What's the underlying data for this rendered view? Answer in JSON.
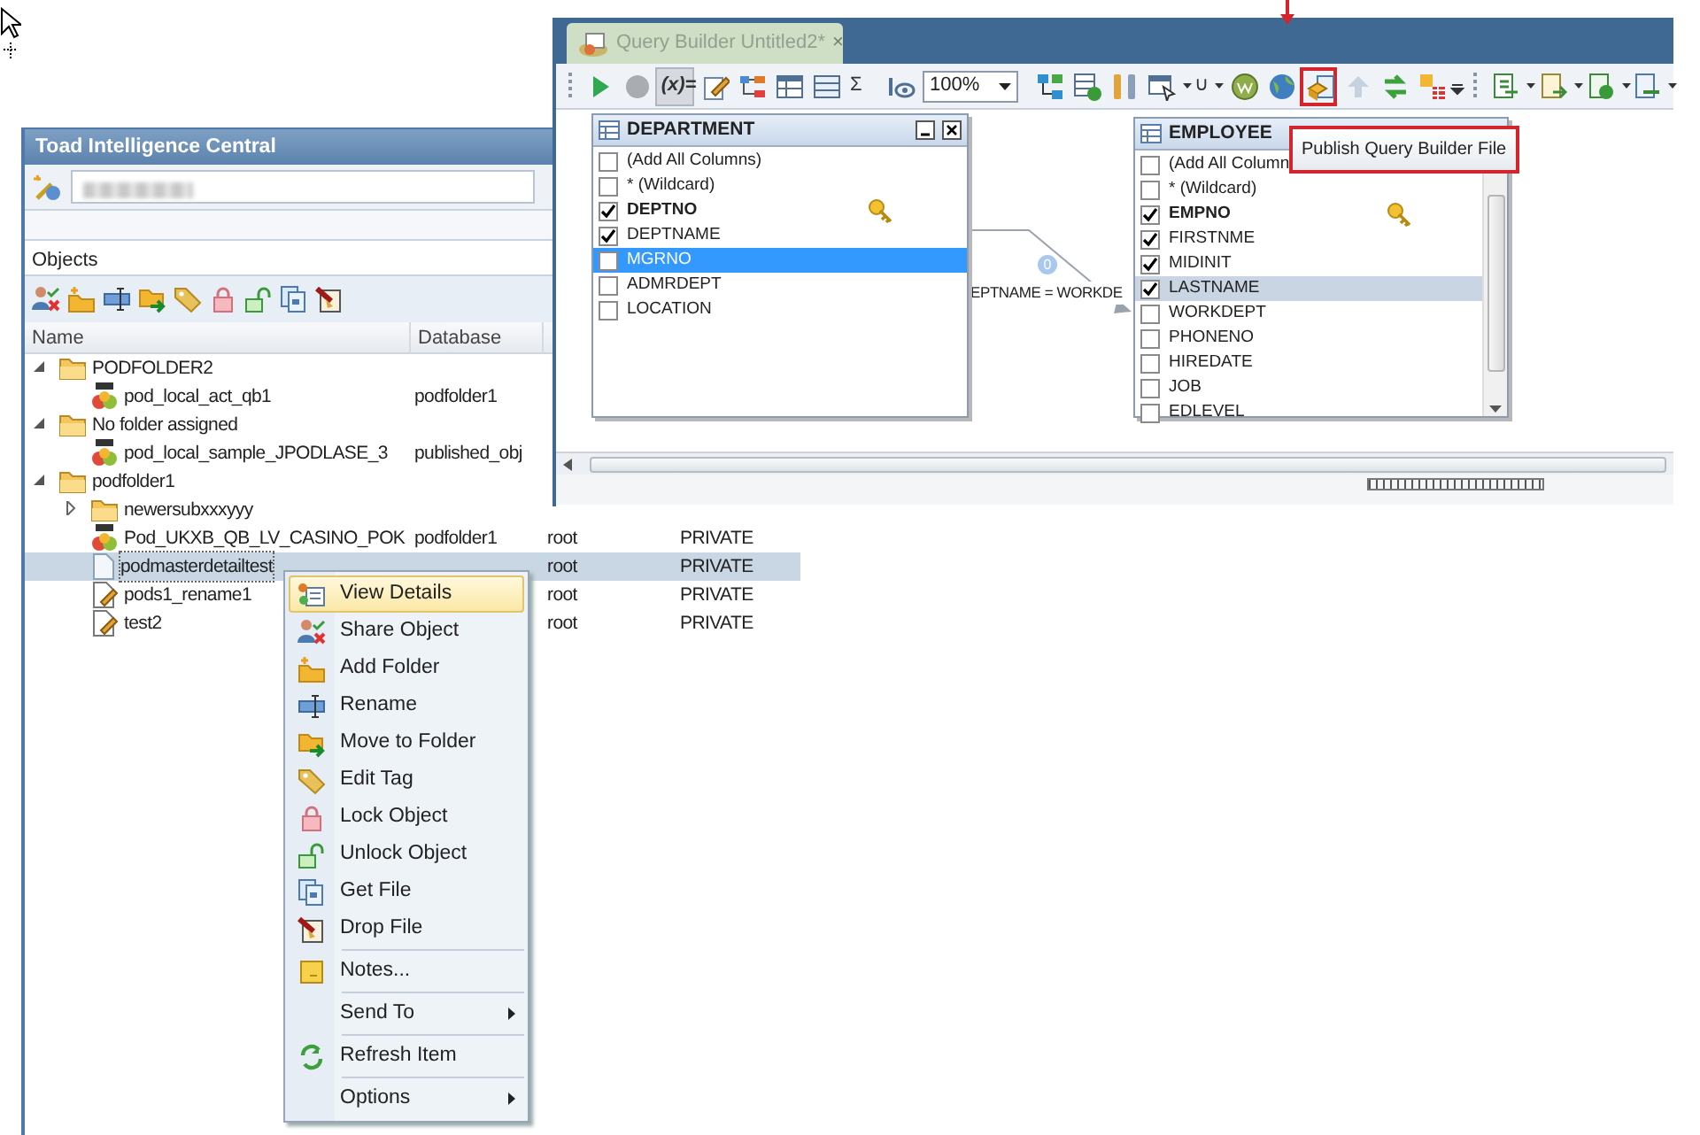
{
  "objects_panel": {
    "title": "Toad Intelligence Central",
    "section": "Objects",
    "columns": [
      "Name",
      "Database"
    ],
    "tree": [
      {
        "name": "PODFOLDER2",
        "kind": "folder",
        "expanded": true,
        "selected": false,
        "children": [
          {
            "name": "pod_local_act_qb1",
            "kind": "query",
            "database": "podfolder1",
            "selected": false
          }
        ]
      },
      {
        "name": "No folder assigned",
        "kind": "folder",
        "expanded": true,
        "selected": false,
        "children": [
          {
            "name": "pod_local_sample_JPODLASE_3",
            "kind": "query",
            "database": "published_obj",
            "selected": false
          }
        ]
      },
      {
        "name": "podfolder1",
        "kind": "folder",
        "expanded": true,
        "selected": false,
        "children": [
          {
            "name": "newersubxxxyyy",
            "kind": "folder",
            "expanded": false,
            "selected": false
          },
          {
            "name": "Pod_UKXB_QB_LV_CASINO_POK",
            "kind": "query",
            "database": "podfolder1",
            "owner": "root",
            "visibility": "PRIVATE",
            "selected": false
          },
          {
            "name": "podmasterdetailtest",
            "kind": "document",
            "owner": "root",
            "visibility": "PRIVATE",
            "selected": true
          },
          {
            "name": "pods1_rename1",
            "kind": "edited",
            "owner": "root",
            "visibility": "PRIVATE",
            "selected": false
          },
          {
            "name": "test2",
            "kind": "edited",
            "owner": "root",
            "visibility": "PRIVATE",
            "selected": false
          }
        ]
      }
    ]
  },
  "query_builder": {
    "tab": {
      "title": "Query Builder Untitled2*",
      "close": "×"
    },
    "toolbar": [
      {
        "kind": "grip"
      },
      {
        "kind": "icon",
        "highlighted": false,
        "disabled": false,
        "dropdown": false
      },
      {
        "kind": "icon",
        "highlighted": false,
        "disabled": false,
        "dropdown": false
      },
      {
        "kind": "text",
        "label": "(x)=",
        "pressed": true,
        "dropdown": false
      },
      {
        "kind": "icon",
        "highlighted": false,
        "disabled": false,
        "dropdown": false
      },
      {
        "kind": "icon",
        "highlighted": false,
        "disabled": false,
        "dropdown": false
      },
      {
        "kind": "icon",
        "highlighted": false,
        "disabled": false,
        "dropdown": false
      },
      {
        "kind": "icon",
        "highlighted": false,
        "disabled": false,
        "dropdown": false
      },
      {
        "kind": "text",
        "label": "Σ",
        "pressed": false,
        "dropdown": false
      },
      {
        "kind": "icon",
        "highlighted": false,
        "disabled": false,
        "dropdown": false
      },
      {
        "kind": "select",
        "value": "100%"
      },
      {
        "kind": "icon",
        "highlighted": false,
        "disabled": false,
        "dropdown": false
      },
      {
        "kind": "icon",
        "highlighted": false,
        "disabled": false,
        "dropdown": false
      },
      {
        "kind": "icon",
        "highlighted": false,
        "disabled": false,
        "dropdown": false
      },
      {
        "kind": "icon",
        "highlighted": false,
        "disabled": false,
        "dropdown": true
      },
      {
        "kind": "text",
        "label": "∪",
        "pressed": false,
        "dropdown": true
      },
      {
        "kind": "icon",
        "highlighted": false,
        "disabled": false,
        "dropdown": false
      },
      {
        "kind": "icon",
        "highlighted": false,
        "disabled": false,
        "dropdown": false
      },
      {
        "kind": "icon",
        "highlighted": true,
        "disabled": false,
        "dropdown": false
      },
      {
        "kind": "icon",
        "highlighted": false,
        "disabled": true,
        "dropdown": false
      },
      {
        "kind": "icon",
        "highlighted": false,
        "disabled": false,
        "dropdown": false
      },
      {
        "kind": "icon",
        "highlighted": false,
        "disabled": false,
        "dropdown": false
      },
      {
        "kind": "overflow"
      },
      {
        "kind": "grip"
      },
      {
        "kind": "icon",
        "highlighted": false,
        "disabled": false,
        "dropdown": true
      },
      {
        "kind": "icon",
        "highlighted": false,
        "disabled": false,
        "dropdown": true
      },
      {
        "kind": "icon",
        "highlighted": false,
        "disabled": false,
        "dropdown": true
      },
      {
        "kind": "icon",
        "highlighted": false,
        "disabled": false,
        "dropdown": true
      }
    ],
    "tables": [
      {
        "title": "DEPARTMENT",
        "window_controls": true,
        "scrollable": false,
        "columns": [
          {
            "label": "(Add All Columns)",
            "checked": false,
            "primary_key": false,
            "selected": false,
            "hovered": false
          },
          {
            "label": "* (Wildcard)",
            "checked": false,
            "primary_key": false,
            "selected": false,
            "hovered": false
          },
          {
            "label": "DEPTNO",
            "checked": true,
            "primary_key": true,
            "selected": false,
            "hovered": false
          },
          {
            "label": "DEPTNAME",
            "checked": true,
            "primary_key": false,
            "selected": false,
            "hovered": false
          },
          {
            "label": "MGRNO",
            "checked": false,
            "primary_key": false,
            "selected": true,
            "hovered": false
          },
          {
            "label": "ADMRDEPT",
            "checked": false,
            "primary_key": false,
            "selected": false,
            "hovered": false
          },
          {
            "label": "LOCATION",
            "checked": false,
            "primary_key": false,
            "selected": false,
            "hovered": false
          }
        ]
      },
      {
        "title": "EMPLOYEE",
        "window_controls": false,
        "scrollable": true,
        "columns": [
          {
            "label": "(Add All Column",
            "checked": false,
            "primary_key": false,
            "selected": false,
            "hovered": false
          },
          {
            "label": "* (Wildcard)",
            "checked": false,
            "primary_key": false,
            "selected": false,
            "hovered": false
          },
          {
            "label": "EMPNO",
            "checked": true,
            "primary_key": true,
            "selected": false,
            "hovered": false
          },
          {
            "label": "FIRSTNME",
            "checked": true,
            "primary_key": false,
            "selected": false,
            "hovered": false
          },
          {
            "label": "MIDINIT",
            "checked": true,
            "primary_key": false,
            "selected": false,
            "hovered": false
          },
          {
            "label": "LASTNAME",
            "checked": true,
            "primary_key": false,
            "selected": false,
            "hovered": true
          },
          {
            "label": "WORKDEPT",
            "checked": false,
            "primary_key": false,
            "selected": false,
            "hovered": false
          },
          {
            "label": "PHONENO",
            "checked": false,
            "primary_key": false,
            "selected": false,
            "hovered": false
          },
          {
            "label": "HIREDATE",
            "checked": false,
            "primary_key": false,
            "selected": false,
            "hovered": false
          },
          {
            "label": "JOB",
            "checked": false,
            "primary_key": false,
            "selected": false,
            "hovered": false
          },
          {
            "label": "EDLEVEL",
            "checked": false,
            "primary_key": false,
            "selected": false,
            "hovered": false
          }
        ]
      }
    ],
    "join": {
      "label": "EPTNAME = WORKDE",
      "badge": "0"
    },
    "tooltip": "Publish Query Builder File"
  },
  "context_menu": {
    "items": [
      {
        "kind": "item",
        "label": "View Details",
        "icon": true,
        "highlighted": true,
        "submenu": false
      },
      {
        "kind": "item",
        "label": "Share Object",
        "icon": true,
        "highlighted": false,
        "submenu": false
      },
      {
        "kind": "item",
        "label": "Add Folder",
        "icon": true,
        "highlighted": false,
        "submenu": false
      },
      {
        "kind": "item",
        "label": "Rename",
        "icon": true,
        "highlighted": false,
        "submenu": false
      },
      {
        "kind": "item",
        "label": "Move to Folder",
        "icon": true,
        "highlighted": false,
        "submenu": false
      },
      {
        "kind": "item",
        "label": "Edit Tag",
        "icon": true,
        "highlighted": false,
        "submenu": false
      },
      {
        "kind": "item",
        "label": "Lock Object",
        "icon": true,
        "highlighted": false,
        "submenu": false
      },
      {
        "kind": "item",
        "label": "Unlock Object",
        "icon": true,
        "highlighted": false,
        "submenu": false
      },
      {
        "kind": "item",
        "label": "Get File",
        "icon": true,
        "highlighted": false,
        "submenu": false
      },
      {
        "kind": "item",
        "label": "Drop File",
        "icon": true,
        "highlighted": false,
        "submenu": false
      },
      {
        "kind": "separator"
      },
      {
        "kind": "item",
        "label": "Notes...",
        "icon": true,
        "highlighted": false,
        "submenu": false
      },
      {
        "kind": "separator"
      },
      {
        "kind": "item",
        "label": "Send To",
        "icon": false,
        "highlighted": false,
        "submenu": true
      },
      {
        "kind": "separator"
      },
      {
        "kind": "item",
        "label": "Refresh Item",
        "icon": true,
        "highlighted": false,
        "submenu": false
      },
      {
        "kind": "separator"
      },
      {
        "kind": "item",
        "label": "Options",
        "icon": false,
        "highlighted": false,
        "submenu": true
      }
    ]
  }
}
